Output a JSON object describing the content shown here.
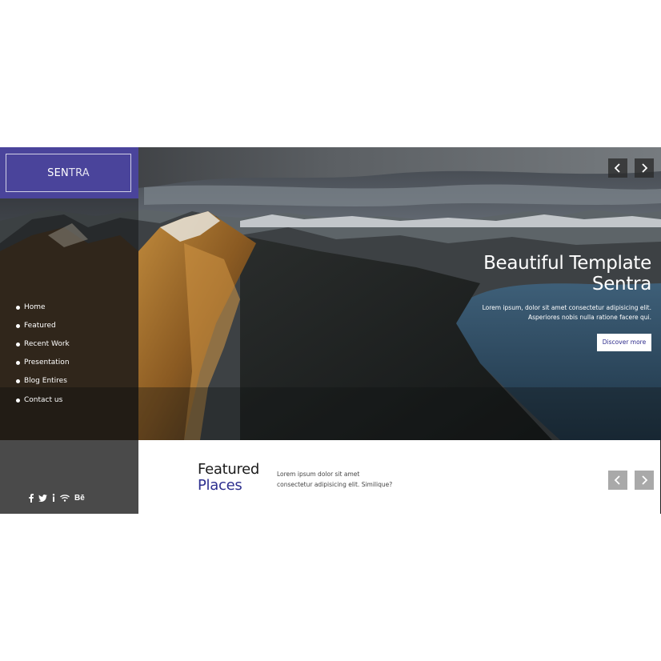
{
  "brand": {
    "logo_bold": "SEN",
    "logo_light": "TRA",
    "accent_color": "#4a449b"
  },
  "sidebar": {
    "nav_items": [
      {
        "label": "Home"
      },
      {
        "label": "Featured"
      },
      {
        "label": "Recent Work"
      },
      {
        "label": "Presentation"
      },
      {
        "label": "Blog Entires"
      },
      {
        "label": "Contact us"
      }
    ],
    "socials": [
      {
        "icon": "facebook-icon"
      },
      {
        "icon": "twitter-icon"
      },
      {
        "icon": "info-icon"
      },
      {
        "icon": "wifi-icon"
      },
      {
        "icon": "behance-icon",
        "text": "Bē"
      }
    ]
  },
  "hero": {
    "title_line1": "Beautiful Template",
    "title_line2": "Sentra",
    "desc_line1": "Lorem ipsum, dolor sit amet consectetur adipisicing elit.",
    "desc_line2": "Asperiores nobis nulla ratione facere qui.",
    "cta_label": "Discover more",
    "prev_icon": "chevron-left-icon",
    "next_icon": "chevron-right-icon"
  },
  "featured": {
    "title_line1": "Featured",
    "title_line2": "Places",
    "desc_line1": "Lorem ipsum dolor sit amet",
    "desc_line2": "consectetur adipisicing elit. Similique?",
    "title_accent_color": "#2d2f8f"
  }
}
